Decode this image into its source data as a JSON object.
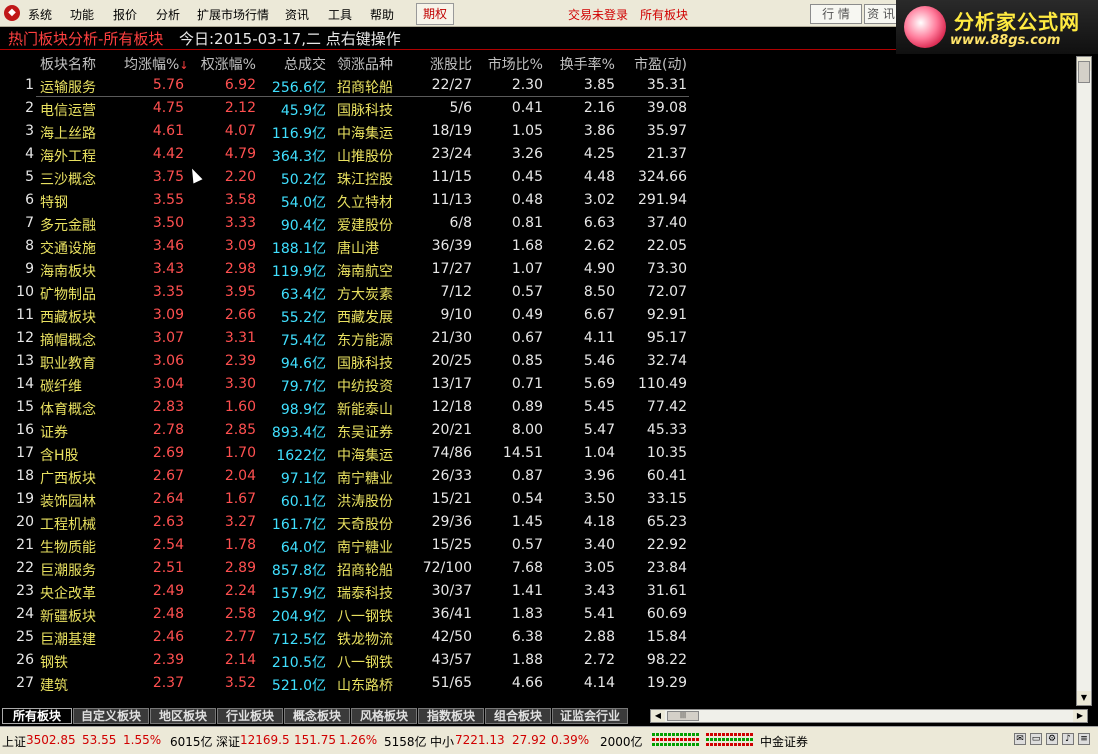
{
  "menu": {
    "items": [
      "系统",
      "功能",
      "报价",
      "分析",
      "扩展市场行情",
      "资讯",
      "工具",
      "帮助"
    ],
    "period": "期权",
    "login": "交易未登录",
    "all_sectors": "所有板块",
    "quote_btn": "行 情",
    "info_btn": "资 讯"
  },
  "brand": {
    "name": "分析家公式网",
    "url": "www.88gs.com"
  },
  "title": {
    "main": "热门板块分析-所有板块",
    "date": "今日:2015-03-17,二   点右键操作"
  },
  "columns": [
    "",
    "板块名称",
    "均涨幅%",
    "权涨幅%",
    "总成交",
    "领涨品种",
    "涨股比",
    "市场比%",
    "换手率%",
    "市盈(动)"
  ],
  "sort_indicator": "↓",
  "volume_unit": "亿",
  "rows": [
    {
      "no": "1",
      "name": "运输服务",
      "avg": "5.76",
      "wgt": "6.92",
      "vol": "256.6",
      "lead": "招商轮船",
      "ratio": "22/27",
      "mkt": "2.30",
      "turn": "3.85",
      "pe": "35.31"
    },
    {
      "no": "2",
      "name": "电信运营",
      "avg": "4.75",
      "wgt": "2.12",
      "vol": "45.9",
      "lead": "国脉科技",
      "ratio": "5/6",
      "mkt": "0.41",
      "turn": "2.16",
      "pe": "39.08"
    },
    {
      "no": "3",
      "name": "海上丝路",
      "avg": "4.61",
      "wgt": "4.07",
      "vol": "116.9",
      "lead": "中海集运",
      "ratio": "18/19",
      "mkt": "1.05",
      "turn": "3.86",
      "pe": "35.97"
    },
    {
      "no": "4",
      "name": "海外工程",
      "avg": "4.42",
      "wgt": "4.79",
      "vol": "364.3",
      "lead": "山推股份",
      "ratio": "23/24",
      "mkt": "3.26",
      "turn": "4.25",
      "pe": "21.37"
    },
    {
      "no": "5",
      "name": "三沙概念",
      "avg": "3.75",
      "wgt": "2.20",
      "vol": "50.2",
      "lead": "珠江控股",
      "ratio": "11/15",
      "mkt": "0.45",
      "turn": "4.48",
      "pe": "324.66"
    },
    {
      "no": "6",
      "name": "特钢",
      "avg": "3.55",
      "wgt": "3.58",
      "vol": "54.0",
      "lead": "久立特材",
      "ratio": "11/13",
      "mkt": "0.48",
      "turn": "3.02",
      "pe": "291.94"
    },
    {
      "no": "7",
      "name": "多元金融",
      "avg": "3.50",
      "wgt": "3.33",
      "vol": "90.4",
      "lead": "爱建股份",
      "ratio": "6/8",
      "mkt": "0.81",
      "turn": "6.63",
      "pe": "37.40"
    },
    {
      "no": "8",
      "name": "交通设施",
      "avg": "3.46",
      "wgt": "3.09",
      "vol": "188.1",
      "lead": "唐山港",
      "ratio": "36/39",
      "mkt": "1.68",
      "turn": "2.62",
      "pe": "22.05"
    },
    {
      "no": "9",
      "name": "海南板块",
      "avg": "3.43",
      "wgt": "2.98",
      "vol": "119.9",
      "lead": "海南航空",
      "ratio": "17/27",
      "mkt": "1.07",
      "turn": "4.90",
      "pe": "73.30"
    },
    {
      "no": "10",
      "name": "矿物制品",
      "avg": "3.35",
      "wgt": "3.95",
      "vol": "63.4",
      "lead": "方大炭素",
      "ratio": "7/12",
      "mkt": "0.57",
      "turn": "8.50",
      "pe": "72.07"
    },
    {
      "no": "11",
      "name": "西藏板块",
      "avg": "3.09",
      "wgt": "2.66",
      "vol": "55.2",
      "lead": "西藏发展",
      "ratio": "9/10",
      "mkt": "0.49",
      "turn": "6.67",
      "pe": "92.91"
    },
    {
      "no": "12",
      "name": "摘帽概念",
      "avg": "3.07",
      "wgt": "3.31",
      "vol": "75.4",
      "lead": "东方能源",
      "ratio": "21/30",
      "mkt": "0.67",
      "turn": "4.11",
      "pe": "95.17"
    },
    {
      "no": "13",
      "name": "职业教育",
      "avg": "3.06",
      "wgt": "2.39",
      "vol": "94.6",
      "lead": "国脉科技",
      "ratio": "20/25",
      "mkt": "0.85",
      "turn": "5.46",
      "pe": "32.74"
    },
    {
      "no": "14",
      "name": "碳纤维",
      "avg": "3.04",
      "wgt": "3.30",
      "vol": "79.7",
      "lead": "中纺投资",
      "ratio": "13/17",
      "mkt": "0.71",
      "turn": "5.69",
      "pe": "110.49"
    },
    {
      "no": "15",
      "name": "体育概念",
      "avg": "2.83",
      "wgt": "1.60",
      "vol": "98.9",
      "lead": "新能泰山",
      "ratio": "12/18",
      "mkt": "0.89",
      "turn": "5.45",
      "pe": "77.42"
    },
    {
      "no": "16",
      "name": "证券",
      "avg": "2.78",
      "wgt": "2.85",
      "vol": "893.4",
      "lead": "东吴证券",
      "ratio": "20/21",
      "mkt": "8.00",
      "turn": "5.47",
      "pe": "45.33"
    },
    {
      "no": "17",
      "name": "含H股",
      "avg": "2.69",
      "wgt": "1.70",
      "vol": "1622",
      "lead": "中海集运",
      "ratio": "74/86",
      "mkt": "14.51",
      "turn": "1.04",
      "pe": "10.35"
    },
    {
      "no": "18",
      "name": "广西板块",
      "avg": "2.67",
      "wgt": "2.04",
      "vol": "97.1",
      "lead": "南宁糖业",
      "ratio": "26/33",
      "mkt": "0.87",
      "turn": "3.96",
      "pe": "60.41"
    },
    {
      "no": "19",
      "name": "装饰园林",
      "avg": "2.64",
      "wgt": "1.67",
      "vol": "60.1",
      "lead": "洪涛股份",
      "ratio": "15/21",
      "mkt": "0.54",
      "turn": "3.50",
      "pe": "33.15"
    },
    {
      "no": "20",
      "name": "工程机械",
      "avg": "2.63",
      "wgt": "3.27",
      "vol": "161.7",
      "lead": "天奇股份",
      "ratio": "29/36",
      "mkt": "1.45",
      "turn": "4.18",
      "pe": "65.23"
    },
    {
      "no": "21",
      "name": "生物质能",
      "avg": "2.54",
      "wgt": "1.78",
      "vol": "64.0",
      "lead": "南宁糖业",
      "ratio": "15/25",
      "mkt": "0.57",
      "turn": "3.40",
      "pe": "22.92"
    },
    {
      "no": "22",
      "name": "巨潮服务",
      "avg": "2.51",
      "wgt": "2.89",
      "vol": "857.8",
      "lead": "招商轮船",
      "ratio": "72/100",
      "mkt": "7.68",
      "turn": "3.05",
      "pe": "23.84"
    },
    {
      "no": "23",
      "name": "央企改革",
      "avg": "2.49",
      "wgt": "2.24",
      "vol": "157.9",
      "lead": "瑞泰科技",
      "ratio": "30/37",
      "mkt": "1.41",
      "turn": "3.43",
      "pe": "31.61"
    },
    {
      "no": "24",
      "name": "新疆板块",
      "avg": "2.48",
      "wgt": "2.58",
      "vol": "204.9",
      "lead": "八一钢铁",
      "ratio": "36/41",
      "mkt": "1.83",
      "turn": "5.41",
      "pe": "60.69"
    },
    {
      "no": "25",
      "name": "巨潮基建",
      "avg": "2.46",
      "wgt": "2.77",
      "vol": "712.5",
      "lead": "铁龙物流",
      "ratio": "42/50",
      "mkt": "6.38",
      "turn": "2.88",
      "pe": "15.84"
    },
    {
      "no": "26",
      "name": "钢铁",
      "avg": "2.39",
      "wgt": "2.14",
      "vol": "210.5",
      "lead": "八一钢铁",
      "ratio": "43/57",
      "mkt": "1.88",
      "turn": "2.72",
      "pe": "98.22"
    },
    {
      "no": "27",
      "name": "建筑",
      "avg": "2.37",
      "wgt": "3.52",
      "vol": "521.0",
      "lead": "山东路桥",
      "ratio": "51/65",
      "mkt": "4.66",
      "turn": "4.14",
      "pe": "19.29"
    }
  ],
  "tabs": [
    "所有板块",
    "自定义板块",
    "地区板块",
    "行业板块",
    "概念板块",
    "风格板块",
    "指数板块",
    "组合板块",
    "证监会行业"
  ],
  "status": {
    "sh_label": "上证",
    "sh_index": "3502.85",
    "sh_change": "53.55",
    "sh_pct": "1.55%",
    "sh_vol": "6015亿",
    "sz_label": "深证",
    "sz_index": "12169.5",
    "sz_change": "151.75",
    "sz_pct": "1.26%",
    "sz_vol": "5158亿",
    "zx_label": "中小",
    "zx_index": "7221.13",
    "zx_change": "27.92",
    "zx_pct": "0.39%",
    "zx_vol": "2000亿",
    "broker": "中金证券"
  },
  "colors": {
    "up": "#ff5050",
    "name": "#e8e060",
    "volume": "#40e0ff",
    "text": "#e8e8e8",
    "background": "#000000"
  }
}
